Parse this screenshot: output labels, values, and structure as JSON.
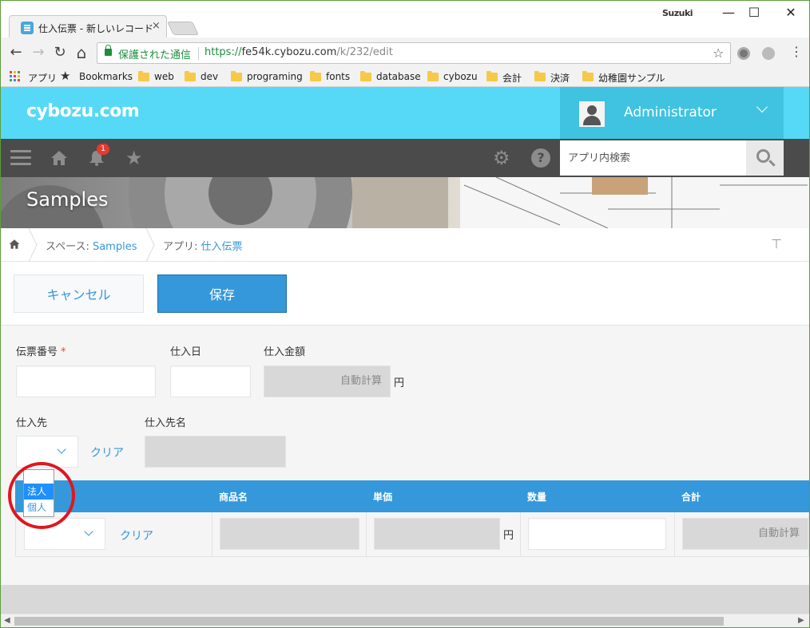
{
  "browser": {
    "tab_title": "仕入伝票 - 新しいレコード",
    "tab_close": "×",
    "user_chip": "Suzuki",
    "window_minimize": "—",
    "window_maximize": "☐",
    "window_close": "✕",
    "back": "←",
    "forward": "→",
    "reload": "↻",
    "home": "⌂",
    "secure_label": "保護された通信",
    "url_scheme": "https://",
    "url_host": "fe54k.cybozu.com",
    "url_path": "/k/232/edit",
    "star": "☆",
    "menu": "⋮"
  },
  "bookmarks": {
    "apps_label": "アプリ",
    "items": [
      "Bookmarks",
      "web",
      "dev",
      "programing",
      "fonts",
      "database",
      "cybozu",
      "会計",
      "決済",
      "幼稚園サンプル"
    ]
  },
  "header": {
    "logo": "cybozu.com",
    "user_name": "Administrator"
  },
  "gnav": {
    "notification_count": "1",
    "search_placeholder": "アプリ内検索",
    "help": "?",
    "settings": "⚙",
    "favorites": "★"
  },
  "banner": {
    "title": "Samples"
  },
  "breadcrumb": {
    "space_label": "スペース: ",
    "space_name": "Samples",
    "app_label": "アプリ: ",
    "app_name": "仕入伝票",
    "pin": "⊤"
  },
  "actions": {
    "cancel_label": "キャンセル",
    "save_label": "保存"
  },
  "form": {
    "slip_number_label": "伝票番号",
    "required_mark": "*",
    "purchase_date_label": "仕入日",
    "purchase_amount_label": "仕入金額",
    "auto_calc": "自動計算",
    "yen": "円",
    "supplier_label": "仕入先",
    "supplier_name_label": "仕入先名",
    "clear_label": "クリア"
  },
  "subtable": {
    "columns": [
      "商品名",
      "単価",
      "数量",
      "合計"
    ],
    "clear_label": "クリア",
    "yen": "円",
    "auto_calc": "自動計算"
  },
  "dropdown": {
    "options": [
      "法人",
      "個人"
    ],
    "selected_index": 0
  },
  "colors": {
    "header": "#56d9f7",
    "accent": "#3498db",
    "highlight": "#e0161f"
  }
}
